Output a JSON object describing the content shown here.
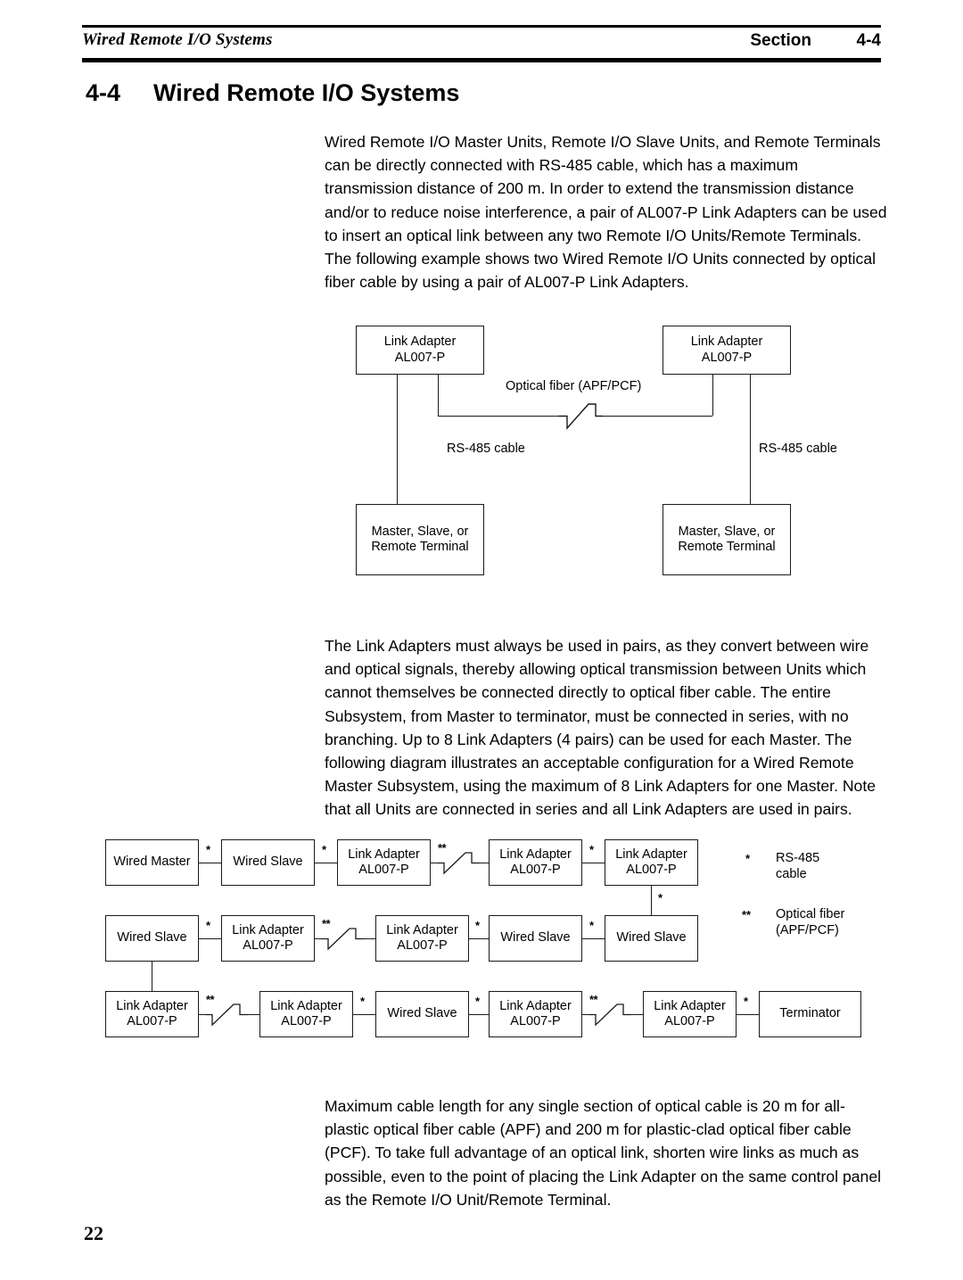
{
  "header": {
    "running_title": "Wired Remote I/O Systems",
    "section_label": "Section",
    "section_number": "4-4"
  },
  "heading": {
    "number": "4-4",
    "text": "Wired Remote I/O Systems"
  },
  "paragraphs": {
    "p1": "Wired Remote I/O Master Units, Remote I/O Slave Units, and Remote Terminals can be directly connected with RS-485 cable, which has a maximum transmission distance of 200 m. In order to extend the transmission distance and/or to reduce noise interference, a pair of AL007-P Link Adapters can be used to insert an optical link between any two Remote I/O Units/Remote Terminals. The following example shows two Wired Remote I/O Units connected by optical fiber cable by using a pair of AL007-P Link Adapters.",
    "p2": "The Link Adapters must always be used in pairs, as they convert between wire and optical signals, thereby allowing optical transmission between Units which cannot themselves be connected directly to optical fiber cable. The entire Subsystem, from Master to terminator, must be connected in series, with no branching. Up to 8 Link Adapters (4 pairs) can be used for each Master. The following diagram illustrates an acceptable configuration for a Wired Remote Master Subsystem, using the maximum of 8 Link Adapters for one Master. Note that all Units are connected in series and all Link Adapters are used in pairs.",
    "p3": "Maximum cable length for any single section of optical cable is 20 m for all-plastic optical fiber cable (APF) and 200 m for plastic-clad optical fiber cable (PCF). To take full advantage of an optical link, shorten wire links as much as possible, even to the point of placing the Link Adapter on the same control panel as the Remote I/O Unit/Remote Terminal."
  },
  "diagram1": {
    "boxes": {
      "link_adapter_left_l1": "Link Adapter",
      "link_adapter_left_l2": "AL007-P",
      "link_adapter_right_l1": "Link Adapter",
      "link_adapter_right_l2": "AL007-P",
      "unit_left_l1": "Master, Slave, or",
      "unit_left_l2": "Remote Terminal",
      "unit_right_l1": "Master, Slave, or",
      "unit_right_l2": "Remote Terminal"
    },
    "labels": {
      "optical_fiber": "Optical fiber (APF/PCF)",
      "rs485_left": "RS-485 cable",
      "rs485_right": "RS-485 cable"
    }
  },
  "diagram2": {
    "row1": {
      "b1": "Wired Master",
      "b2": "Wired Slave",
      "b3_l1": "Link Adapter",
      "b3_l2": "AL007-P",
      "b4_l1": "Link Adapter",
      "b4_l2": "AL007-P",
      "b5_l1": "Link Adapter",
      "b5_l2": "AL007-P",
      "m1": "*",
      "m2": "*",
      "m3": "**",
      "m4": "*"
    },
    "row2": {
      "b1": "Wired Slave",
      "b2_l1": "Link Adapter",
      "b2_l2": "AL007-P",
      "b3_l1": "Link Adapter",
      "b3_l2": "AL007-P",
      "b4": "Wired Slave",
      "b5": "Wired Slave",
      "m1": "*",
      "m2": "**",
      "m3": "*",
      "m4": "*",
      "drop": "*"
    },
    "row3": {
      "b1_l1": "Link Adapter",
      "b1_l2": "AL007-P",
      "b2_l1": "Link Adapter",
      "b2_l2": "AL007-P",
      "b3": "Wired Slave",
      "b4_l1": "Link Adapter",
      "b4_l2": "AL007-P",
      "b5_l1": "Link Adapter",
      "b5_l2": "AL007-P",
      "b6": "Terminator",
      "m1": "**",
      "m2": "*",
      "m3": "*",
      "m4": "**",
      "m5": "*"
    },
    "legend": {
      "mark1": "*",
      "text1_l1": "RS-485",
      "text1_l2": "cable",
      "mark2": "**",
      "text2_l1": "Optical fiber",
      "text2_l2": "(APF/PCF)"
    }
  },
  "footer": {
    "page_number": "22"
  }
}
